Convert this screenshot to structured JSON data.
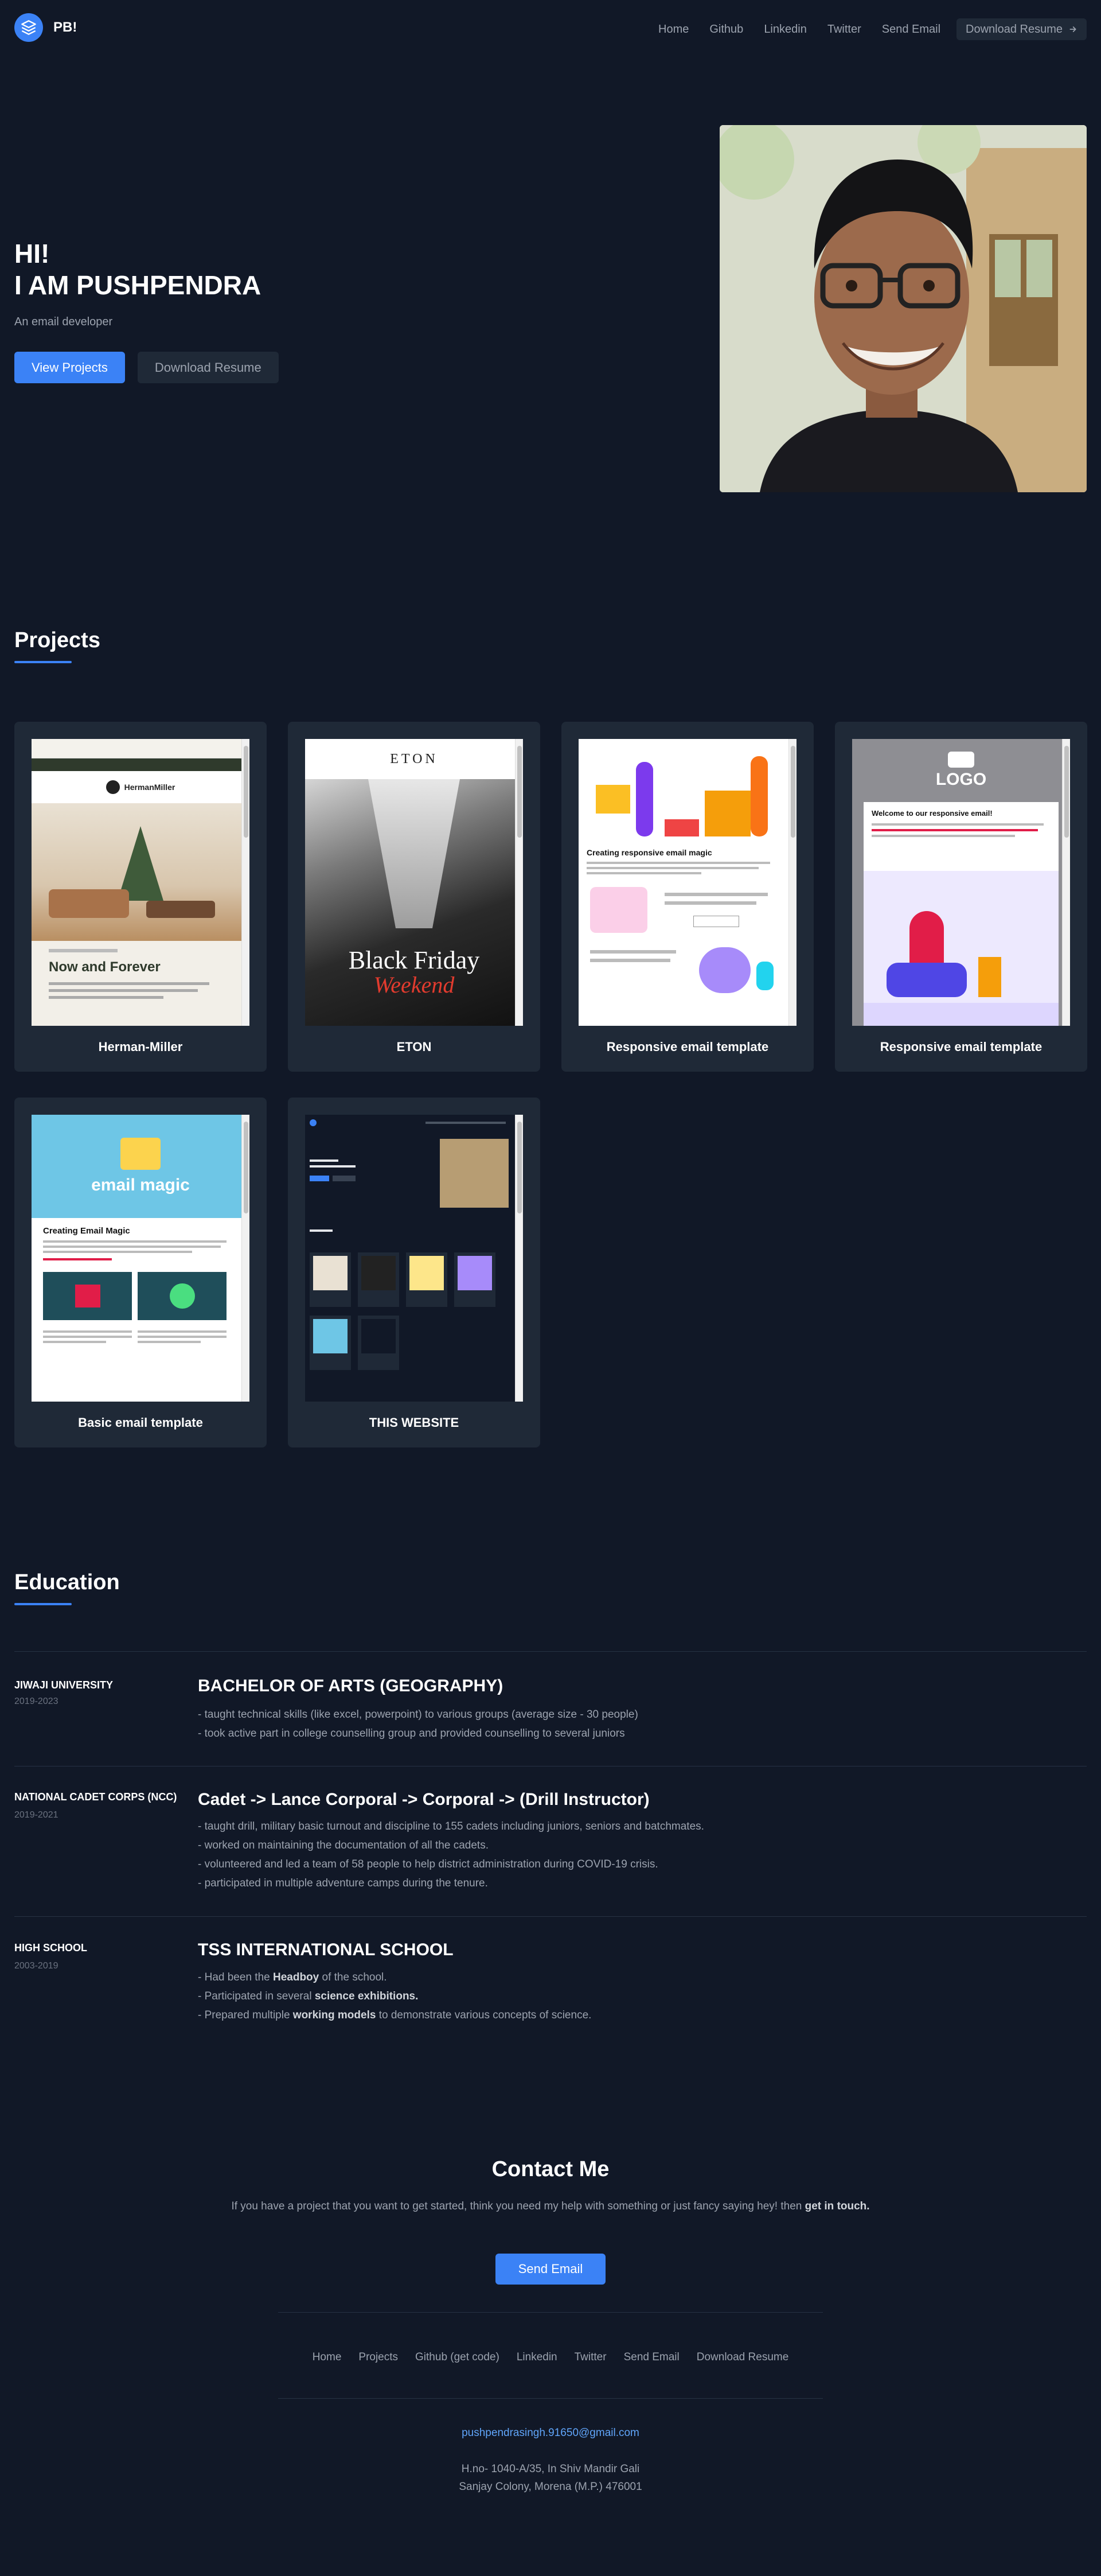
{
  "nav": {
    "logo_text": "PB!",
    "links": [
      "Home",
      "Github",
      "Linkedin",
      "Twitter",
      "Send Email"
    ],
    "download_label": "Download Resume"
  },
  "hero": {
    "greeting": "HI!",
    "name": "I AM PUSHPENDRA",
    "subtitle": "An email developer",
    "primary_button": "View Projects",
    "secondary_button": "Download Resume"
  },
  "projects": {
    "title": "Projects",
    "items": [
      {
        "title": "Herman-Miller",
        "preview_heading": "Now and Forever",
        "preview_brand": "HermanMiller"
      },
      {
        "title": "ETON",
        "preview_heading": "Black Friday",
        "preview_brand": "ETON",
        "preview_sub": "Weekend"
      },
      {
        "title": "Responsive email template",
        "preview_heading": "Creating responsive email magic"
      },
      {
        "title": "Responsive email template",
        "preview_heading": "Welcome to our responsive email!",
        "preview_brand": "LOGO"
      },
      {
        "title": "Basic email template",
        "preview_heading": "Creating Email Magic",
        "preview_brand": "email magic"
      },
      {
        "title": "THIS WEBSITE"
      }
    ]
  },
  "education": {
    "title": "Education",
    "entries": [
      {
        "org": "JIWAJI UNIVERSITY",
        "years": "2019-2023",
        "degree": "BACHELOR OF ARTS (GEOGRAPHY)",
        "lines": [
          "- taught technical skills (like excel, powerpoint) to various groups (average size - 30 people)",
          "- took active part in college counselling group and provided counselling to several juniors"
        ]
      },
      {
        "org": "NATIONAL CADET CORPS (NCC)",
        "years": "2019-2021",
        "degree": "Cadet -> Lance Corporal -> Corporal -> (Drill Instructor)",
        "lines": [
          "- taught drill, military basic turnout and discipline to 155 cadets including juniors, seniors and batchmates.",
          "- worked on maintaining the documentation of all the cadets.",
          "- volunteered and led a team of 58 people to help district administration during COVID-19 crisis.",
          "- participated in multiple adventure camps during the tenure."
        ]
      },
      {
        "org": "HIGH SCHOOL",
        "years": "2003-2019",
        "degree": "TSS INTERNATIONAL SCHOOL",
        "l1_pre": "- Had been the ",
        "l1_bold": "Headboy",
        "l1_post": " of the school.",
        "l2_pre": "- Participated in several ",
        "l2_bold": "science exhibitions.",
        "l3_pre": "- Prepared multiple ",
        "l3_bold": "working models",
        "l3_post": " to demonstrate various concepts of science."
      }
    ]
  },
  "contact": {
    "title": "Contact Me",
    "text_pre": "If you have a project that you want to get started, think you need my help with something or just fancy saying hey! then ",
    "text_bold": "get in touch.",
    "button": "Send Email"
  },
  "footer": {
    "links": [
      "Home",
      "Projects",
      "Github (get code)",
      "Linkedin",
      "Twitter",
      "Send Email",
      "Download Resume"
    ],
    "email": "pushpendrasingh.91650@gmail.com",
    "address_line1": "H.no- 1040-A/35, In Shiv Mandir Gali",
    "address_line2": "Sanjay Colony, Morena (M.P.) 476001"
  },
  "colors": {
    "background": "#111827",
    "card": "#1f2937",
    "accent": "#3b82f6",
    "muted_text": "#9ca3af"
  },
  "icons": {
    "logo": "layers-icon",
    "download_arrow": "arrow-right-icon"
  }
}
